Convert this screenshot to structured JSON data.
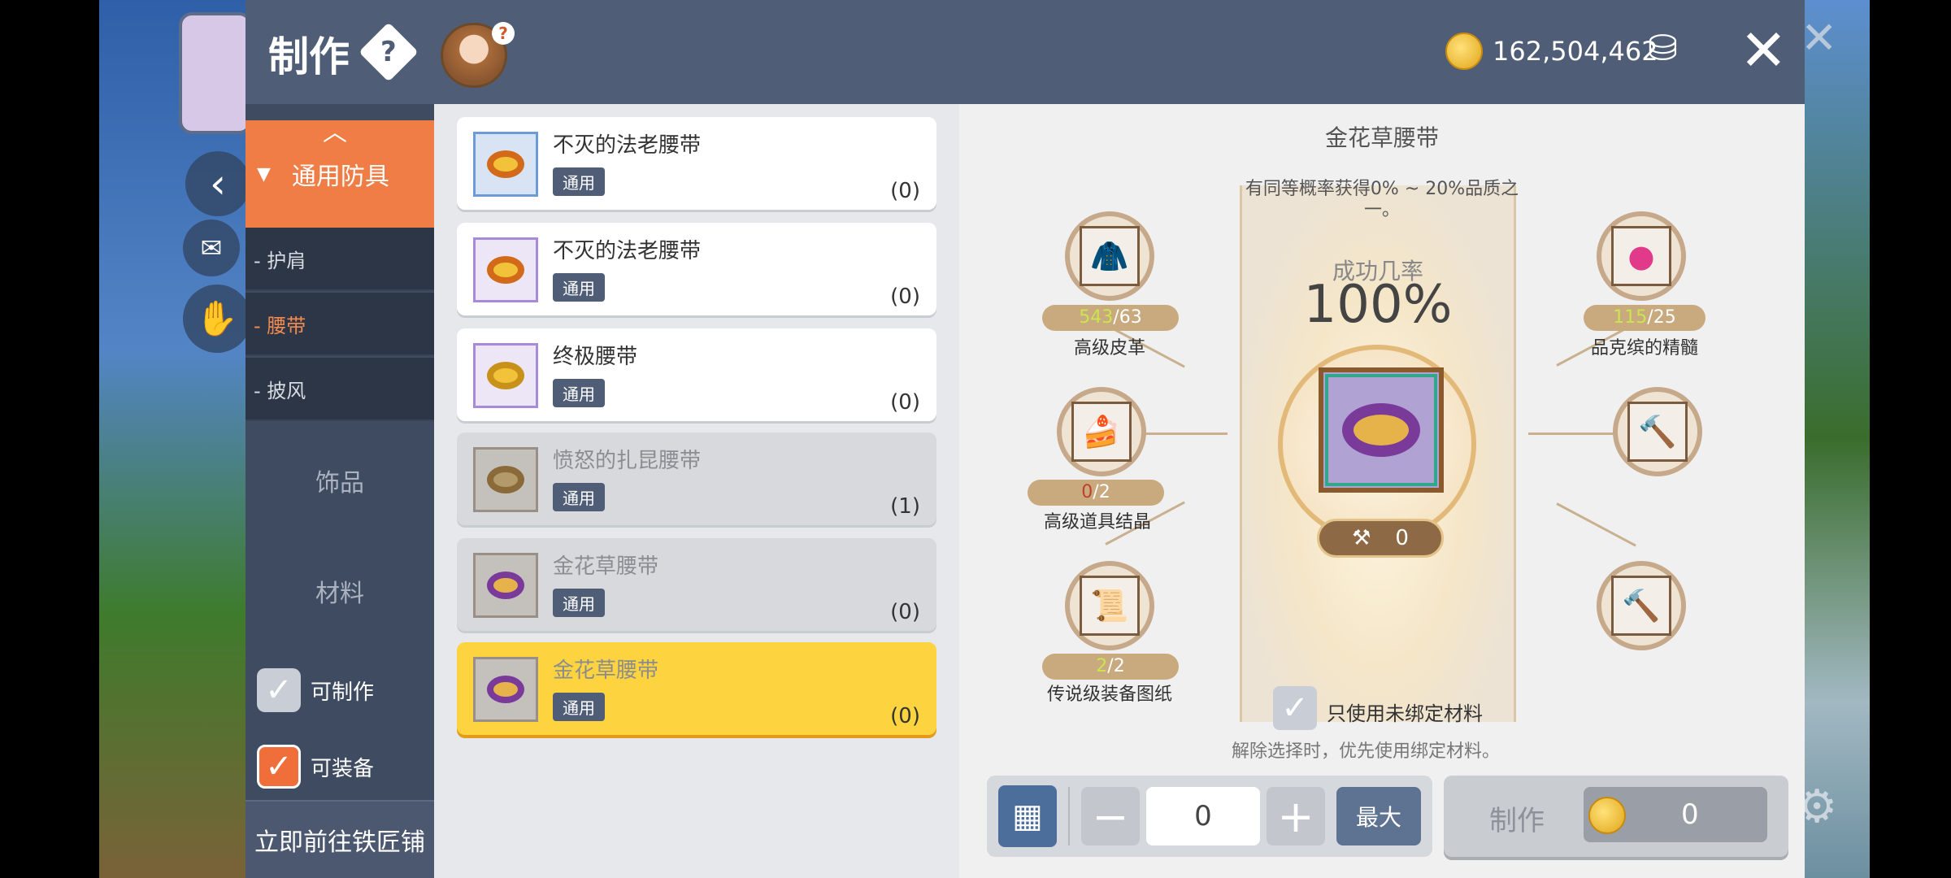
{
  "header": {
    "title": "制作",
    "help_icon": "?",
    "gold": "162,504,462",
    "close_icon": "✕"
  },
  "sidebar": {
    "active_category": "通用防具",
    "subcategories": [
      "- 护肩",
      "- 腰带",
      "- 披风"
    ],
    "categories": [
      "饰品",
      "材料"
    ],
    "filters": [
      {
        "label": "可制作",
        "checked": false
      },
      {
        "label": "可装备",
        "checked": true
      }
    ],
    "goto_label": "立即前往铁匠铺"
  },
  "items": [
    {
      "name": "不灭的法老腰带",
      "tag": "通用",
      "count": "(0)"
    },
    {
      "name": "不灭的法老腰带",
      "tag": "通用",
      "count": "(0)"
    },
    {
      "name": "终极腰带",
      "tag": "通用",
      "count": "(0)"
    },
    {
      "name": "愤怒的扎昆腰带",
      "tag": "通用",
      "count": "(1)"
    },
    {
      "name": "金花草腰带",
      "tag": "通用",
      "count": "(0)"
    },
    {
      "name": "金花草腰带",
      "tag": "通用",
      "count": "(0)"
    }
  ],
  "detail": {
    "name": "金花草腰带",
    "probability_note": "有同等概率获得0% ~ 20%品质之一。",
    "success_label": "成功几率",
    "success_rate": "100%",
    "hammer_count": "0",
    "materials": [
      {
        "name": "高级皮革",
        "have": "543",
        "need": "/63"
      },
      {
        "name": "高级道具结晶",
        "have": "0",
        "need": "/2"
      },
      {
        "name": "传说级装备图纸",
        "have": "2",
        "need": "/2"
      },
      {
        "name": "品克缤的精髓",
        "have": "115",
        "need": "/25"
      }
    ],
    "only_unbound_label": "只使用未绑定材料",
    "note": "解除选择时，优先使用绑定材料。",
    "quantity": "0",
    "max_label": "最大",
    "make_label": "制作",
    "make_cost": "0"
  },
  "colors": {
    "header_bg": "#4f5d77",
    "accent_orange": "#ef7d45",
    "selected_item": "#fdd43f"
  }
}
